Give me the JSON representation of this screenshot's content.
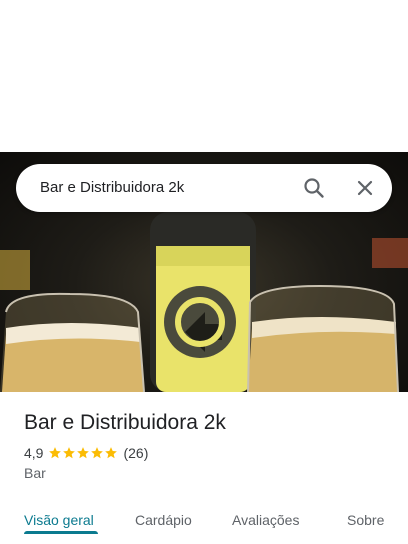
{
  "search": {
    "query": "Bar e Distribuidora 2k",
    "search_icon": "search-icon",
    "close_icon": "close-icon"
  },
  "place": {
    "name": "Bar e Distribuidora 2k",
    "rating": "4,9",
    "stars": 5,
    "reviews": "(26)",
    "category": "Bar"
  },
  "tabs": [
    {
      "label": "Visão geral",
      "active": true
    },
    {
      "label": "Cardápio",
      "active": false
    },
    {
      "label": "Avaliações",
      "active": false
    },
    {
      "label": "Sobre",
      "active": false
    }
  ],
  "colors": {
    "accent": "#0b7a8f",
    "star": "#fbbc04"
  }
}
